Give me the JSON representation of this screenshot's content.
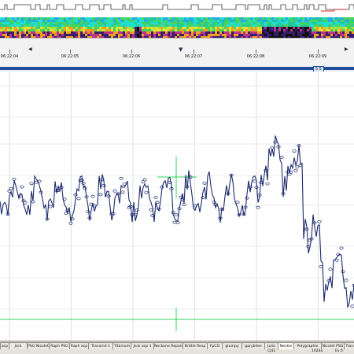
{
  "time_axis": {
    "labels": [
      "06:22:04",
      "06:22:05",
      "06:22:06",
      "06:22:07",
      "06:22:08",
      "06:22:09"
    ]
  },
  "page_indicator": "5.5",
  "tabs": [
    "acp",
    "Jsck",
    "PSG Nicolet",
    "Raph PSG",
    "Raph acp",
    "Transmit 1",
    "Titanium",
    "Jsck acp 1",
    "Neckone Repair",
    "Brittle Resp",
    "FpCO",
    "glumpy",
    "garybilee",
    "Julia",
    "Neckle",
    "Polygraphie",
    "Nicolet PSG",
    "Transmit 1",
    "Ne"
  ],
  "active_tab": "Neckle",
  "status_bar": {
    "left": "CJ42",
    "right": [
      "1024x",
      "Ev 0"
    ]
  },
  "colors": {
    "trace": "#1d2a6e",
    "grid": "#d0dcd2",
    "crosshair": "#2bd45a",
    "scroll_thumb": "#1f4f9c",
    "status_trace": "#333333",
    "status_marker": "#d42020"
  }
}
